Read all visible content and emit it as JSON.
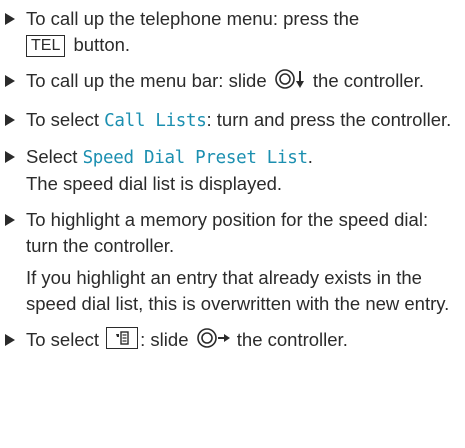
{
  "steps": [
    {
      "pre": "To call up the telephone menu: press the",
      "key": "TEL",
      "post": "button."
    },
    {
      "pre": "To call up the menu bar: slide",
      "post": "the controller."
    },
    {
      "pre": "To select",
      "menu": "Call Lists",
      "post": ": turn and press the controller."
    },
    {
      "pre": "Select",
      "menu": "Speed Dial Preset List",
      "post": ".",
      "result": "The speed dial list is displayed."
    },
    {
      "text": "To highlight a memory position for the speed dial: turn the controller.",
      "note": "If you highlight an entry that already exists in the speed dial list, this is overwritten with the new entry."
    },
    {
      "pre": "To select",
      "mid": ": slide",
      "post": "the controller."
    }
  ],
  "icons": {
    "bullet": "triangle-right-icon",
    "controller_down": "controller-slide-down-icon",
    "controller_right": "controller-slide-right-icon",
    "speed_dial_key": "phonebook-softkey-icon"
  },
  "colors": {
    "text": "#2b2b2b",
    "menu_item": "#1b8fb0"
  }
}
